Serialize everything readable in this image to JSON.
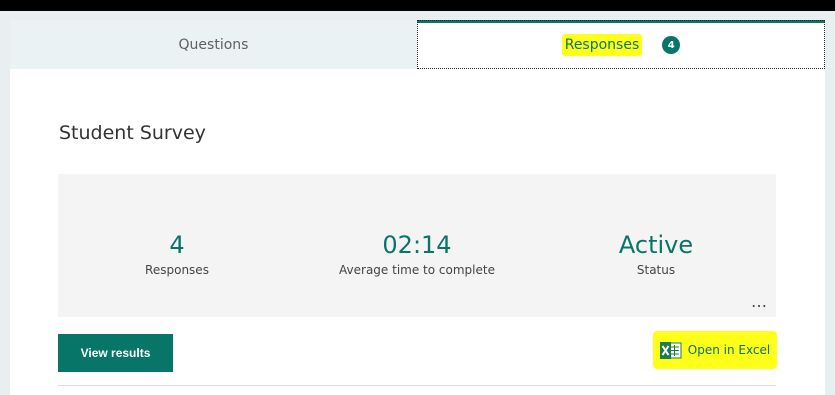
{
  "tabs": {
    "questions_label": "Questions",
    "responses_label": "Responses",
    "responses_count": "4",
    "active_tab": "Responses"
  },
  "survey": {
    "title": "Student Survey"
  },
  "stats": [
    {
      "value": "4",
      "label": "Responses"
    },
    {
      "value": "02:14",
      "label": "Average time to complete"
    },
    {
      "value": "Active",
      "label": "Status"
    }
  ],
  "more_icon": "…",
  "actions": {
    "view_results_label": "View results",
    "open_excel_label": "Open in Excel"
  },
  "colors": {
    "accent": "#077568",
    "highlight": "#ffff1a",
    "excel_green": "#1d7d45"
  },
  "icons": {
    "excel": "excel-icon",
    "more": "more-options-icon"
  }
}
